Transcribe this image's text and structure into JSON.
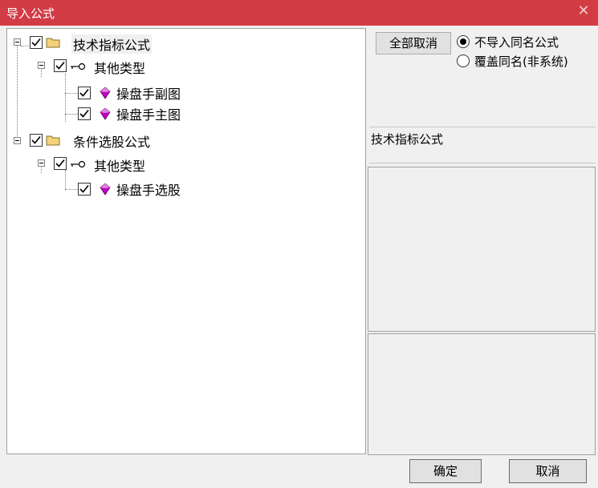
{
  "window": {
    "title": "导入公式",
    "close_glyph": "✕"
  },
  "tree": {
    "root1": {
      "label": "技术指标公式",
      "child": {
        "label": "其他类型",
        "items": [
          "操盘手副图",
          "操盘手主图"
        ]
      }
    },
    "root2": {
      "label": "条件选股公式",
      "child": {
        "label": "其他类型",
        "items": [
          "操盘手选股"
        ]
      }
    }
  },
  "options": {
    "deselect_all": "全部取消",
    "radio1": "不导入同名公式",
    "radio2": "覆盖同名(非系统)",
    "selected": "radio1"
  },
  "info": {
    "title": "技术指标公式"
  },
  "footer": {
    "ok": "确定",
    "cancel": "取消"
  },
  "colors": {
    "titlebar": "#d23c44",
    "gem": "#c000c0"
  }
}
